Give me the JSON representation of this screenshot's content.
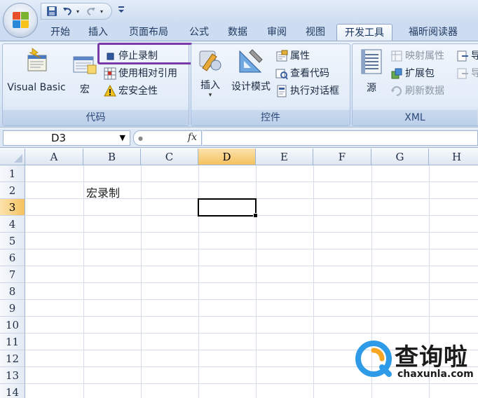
{
  "quick_access": {
    "save_icon": "save-icon",
    "undo_icon": "undo-icon",
    "redo_icon": "redo-icon",
    "customize_icon": "customize-qat-icon"
  },
  "tabs": [
    "开始",
    "插入",
    "页面布局",
    "公式",
    "数据",
    "审阅",
    "视图",
    "开发工具",
    "福昕阅读器"
  ],
  "active_tab": "开发工具",
  "ribbon": {
    "code": {
      "label": "代码",
      "visual_basic": "Visual Basic",
      "macros": "宏",
      "stop_recording": "停止录制",
      "relative_refs": "使用相对引用",
      "macro_security": "宏安全性"
    },
    "controls": {
      "label": "控件",
      "insert": "插入",
      "design_mode": "设计模式",
      "properties": "属性",
      "view_code": "查看代码",
      "run_dialog": "执行对话框"
    },
    "xml": {
      "label": "XML",
      "source": "源",
      "map_properties": "映射属性",
      "expansion_packs": "扩展包",
      "refresh_data": "刷新数据",
      "import_partial": "导",
      "export_partial": "导"
    }
  },
  "formula_bar": {
    "name_box": "D3",
    "fx_label": "fx",
    "formula": ""
  },
  "sheet": {
    "columns": [
      "A",
      "B",
      "C",
      "D",
      "E",
      "F",
      "G",
      "H"
    ],
    "rows": [
      "1",
      "2",
      "3",
      "4",
      "5",
      "6",
      "7",
      "8",
      "9",
      "10",
      "11",
      "12",
      "13",
      "14"
    ],
    "selected_column": "D",
    "selected_row": "3",
    "cells": {
      "B2": "宏录制"
    }
  },
  "watermark": {
    "name": "查询啦",
    "url": "chaxunla.com"
  },
  "colors": {
    "highlight_box": "#7a3aa8",
    "selected_header": "#f5c15e",
    "ribbon_bg": "#dae6f6"
  }
}
